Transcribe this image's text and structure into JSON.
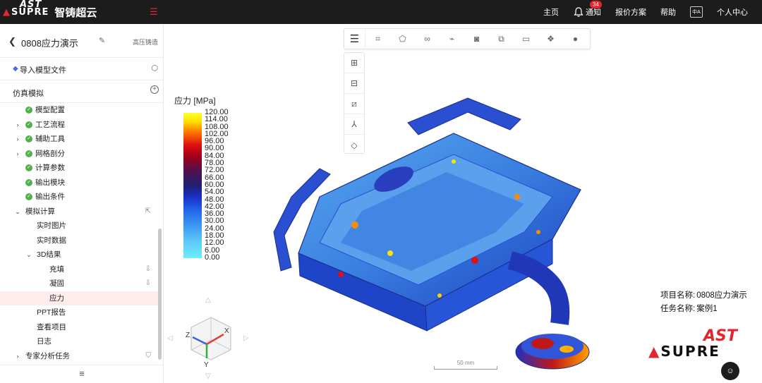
{
  "header": {
    "logo_en": "SUPRE",
    "logo_ast": "AST",
    "logo_cn": "智铸超云",
    "nav": {
      "home": "主页",
      "notify": "通知",
      "notify_count": "34",
      "pricing": "报价方案",
      "help": "帮助",
      "lang": "中A",
      "profile": "个人中心"
    }
  },
  "sidebar": {
    "project_title": "0808应力演示",
    "project_tag": "高压铸造",
    "import_label": "导入模型文件",
    "sim_label": "仿真模拟",
    "tree": [
      {
        "label": "模型配置",
        "level": 1,
        "check": true,
        "caret": "",
        "active": false,
        "side": ""
      },
      {
        "label": "工艺流程",
        "level": 1,
        "check": true,
        "caret": "›",
        "active": false,
        "side": ""
      },
      {
        "label": "辅助工具",
        "level": 1,
        "check": true,
        "caret": "›",
        "active": false,
        "side": ""
      },
      {
        "label": "网格剖分",
        "level": 1,
        "check": true,
        "caret": "›",
        "active": false,
        "side": ""
      },
      {
        "label": "计算参数",
        "level": 1,
        "check": true,
        "caret": "",
        "active": false,
        "side": ""
      },
      {
        "label": "输出模块",
        "level": 1,
        "check": true,
        "caret": "",
        "active": false,
        "side": ""
      },
      {
        "label": "输出条件",
        "level": 1,
        "check": true,
        "caret": "",
        "active": false,
        "side": ""
      },
      {
        "label": "模拟计算",
        "level": 1,
        "check": false,
        "caret": "⌄",
        "active": false,
        "side": "share"
      },
      {
        "label": "实时图片",
        "level": 2,
        "check": false,
        "caret": "",
        "active": false,
        "side": ""
      },
      {
        "label": "实时数据",
        "level": 2,
        "check": false,
        "caret": "",
        "active": false,
        "side": ""
      },
      {
        "label": "3D结果",
        "level": 2,
        "check": false,
        "caret": "⌄",
        "active": false,
        "side": ""
      },
      {
        "label": "充填",
        "level": 3,
        "check": false,
        "caret": "",
        "active": false,
        "side": "download"
      },
      {
        "label": "凝固",
        "level": 3,
        "check": false,
        "caret": "",
        "active": false,
        "side": "download"
      },
      {
        "label": "应力",
        "level": 3,
        "check": false,
        "caret": "",
        "active": true,
        "side": ""
      },
      {
        "label": "PPT报告",
        "level": 2,
        "check": false,
        "caret": "",
        "active": false,
        "side": ""
      },
      {
        "label": "查看项目",
        "level": 2,
        "check": false,
        "caret": "",
        "active": false,
        "side": ""
      },
      {
        "label": "日志",
        "level": 2,
        "check": false,
        "caret": "",
        "active": false,
        "side": ""
      },
      {
        "label": "专家分析任务",
        "level": 1,
        "check": false,
        "caret": "›",
        "active": false,
        "side": "shield"
      }
    ]
  },
  "viewport": {
    "legend_title": "应力 [MPa]",
    "legend_ticks": [
      "120.00",
      "114.00",
      "108.00",
      "102.00",
      "96.00",
      "90.00",
      "84.00",
      "78.00",
      "72.00",
      "66.00",
      "60.00",
      "54.00",
      "48.00",
      "42.00",
      "36.00",
      "30.00",
      "24.00",
      "18.00",
      "12.00",
      "6.00",
      "0.00"
    ],
    "info_project_label": "项目名称:",
    "info_project_value": "0808应力演示",
    "info_task_label": "任务名称:",
    "info_task_value": "案例1",
    "scale_label": "50 mm",
    "axis_x": "X",
    "axis_y": "Y",
    "axis_z": "Z"
  },
  "colors": {
    "accent": "#e3262d",
    "topbar": "#1c1c1c",
    "active_row": "#fdeceb",
    "check": "#52b04c"
  }
}
